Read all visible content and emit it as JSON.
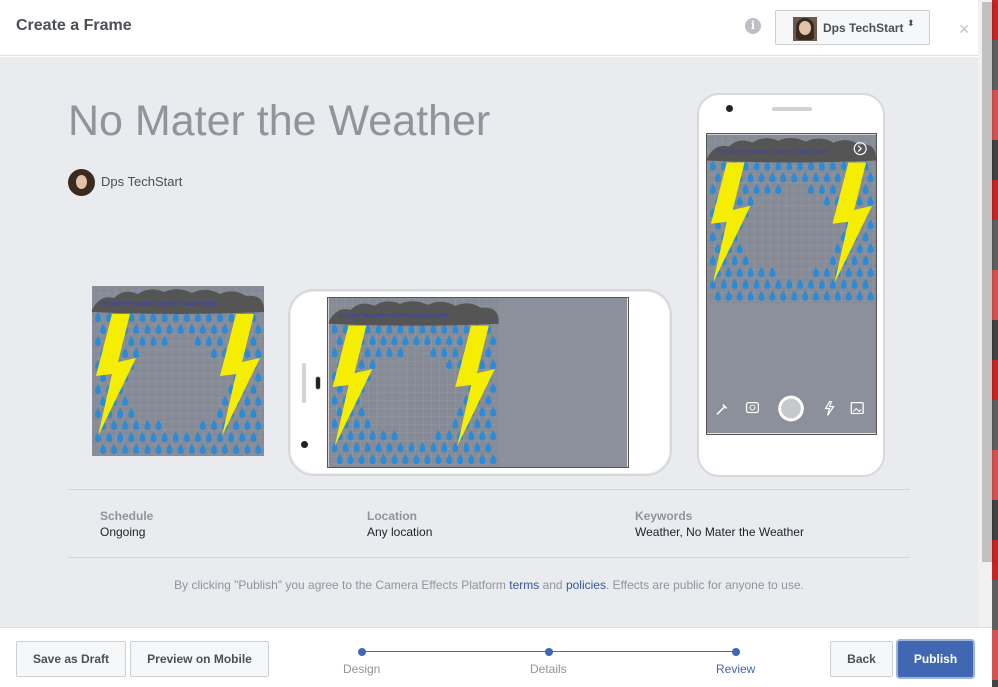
{
  "header": {
    "title": "Create a Frame",
    "info_icon": "i",
    "account_name": "Dps TechStart",
    "account_caret": "⬍",
    "close_icon": "×"
  },
  "effect": {
    "title": "No Mater the Weather",
    "owner": "Dps TechStart",
    "frame_caption": "No mater the weather Danville is always better"
  },
  "meta": {
    "schedule_label": "Schedule",
    "schedule_value": "Ongoing",
    "location_label": "Location",
    "location_value": "Any location",
    "keywords_label": "Keywords",
    "keywords_value": "Weather, No Mater the Weather"
  },
  "agreement": {
    "prefix": "By clicking \"Publish\" you agree to the Camera Effects Platform ",
    "terms": "terms",
    "and": " and ",
    "policies": "policies",
    "suffix": ". Effects are public for anyone to use."
  },
  "footer": {
    "save_draft": "Save as Draft",
    "preview_mobile": "Preview on Mobile",
    "steps": [
      "Design",
      "Details",
      "Review"
    ],
    "active_step": "Review",
    "back": "Back",
    "publish": "Publish"
  },
  "colors": {
    "accent": "#4267b2",
    "frame_bg": "#868b96",
    "raindrop": "#2b8bd6",
    "lightning": "#f5ee00",
    "cloud": "#555555"
  }
}
